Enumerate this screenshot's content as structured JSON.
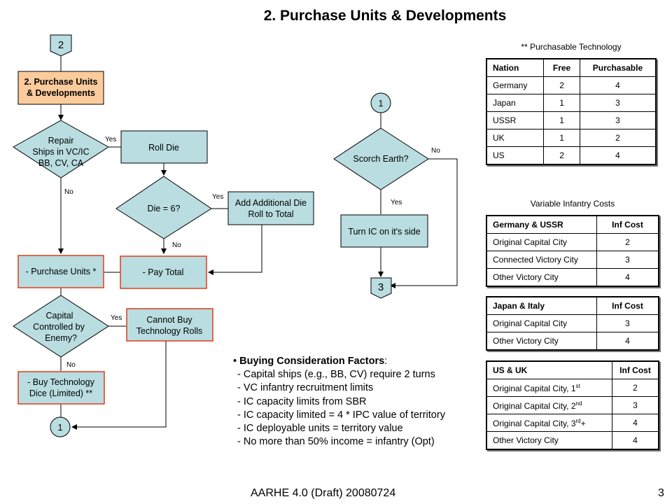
{
  "title": "2. Purchase Units & Developments",
  "flowchart": {
    "start_connector": "2",
    "start_box": [
      "2. Purchase Units",
      "& Developments"
    ],
    "repair_decision": [
      "Repair",
      "Ships in VC/IC",
      "BB, CV, CA"
    ],
    "roll_die": "Roll Die",
    "die6_decision": "Die = 6?",
    "add_die": [
      "Add Additional Die",
      "Roll to Total"
    ],
    "pay_total": "- Pay Total",
    "purchase_units": "- Purchase Units *",
    "capital_decision": [
      "Capital",
      "Controlled by",
      "Enemy?"
    ],
    "cannot_buy": [
      "Cannot Buy",
      "Technology Rolls"
    ],
    "buy_tech": [
      "- Buy Technology",
      "Dice (Limited) **"
    ],
    "connector_1_left": "1",
    "connector_1_right": "1",
    "scorch_decision": "Scorch Earth?",
    "turn_ic": "Turn IC on it's side",
    "end_connector": "3",
    "yes": "Yes",
    "no": "No",
    "colors": {
      "box_fill": "#b9dde0",
      "start_fill": "#fbcb9c",
      "red_border": "#e23b1a"
    }
  },
  "tech_table": {
    "caption": "** Purchasable Technology",
    "headers": [
      "Nation",
      "Free",
      "Purchasable"
    ],
    "rows": [
      [
        "Germany",
        "2",
        "4"
      ],
      [
        "Japan",
        "1",
        "3"
      ],
      [
        "USSR",
        "1",
        "3"
      ],
      [
        "UK",
        "1",
        "2"
      ],
      [
        "US",
        "2",
        "4"
      ]
    ]
  },
  "infantry": {
    "caption": "Variable Infantry Costs",
    "germany_ussr": {
      "headers": [
        "Germany & USSR",
        "Inf Cost"
      ],
      "rows": [
        [
          "Original Capital City",
          "2"
        ],
        [
          "Connected Victory City",
          "3"
        ],
        [
          "Other Victory City",
          "4"
        ]
      ]
    },
    "japan_italy": {
      "headers": [
        "Japan & Italy",
        "Inf Cost"
      ],
      "rows": [
        [
          "Original Capital City",
          "3"
        ],
        [
          "Other Victory City",
          "4"
        ]
      ]
    },
    "us_uk": {
      "headers": [
        "US & UK",
        "Inf Cost"
      ],
      "rows": [
        [
          "Original Capital City, 1",
          "st",
          "2"
        ],
        [
          "Original Capital City, 2",
          "nd",
          "3"
        ],
        [
          "Original Capital City, 3",
          "rd",
          "+",
          "4"
        ],
        [
          "Other Victory City",
          "4"
        ]
      ]
    }
  },
  "factors": {
    "bullet": "•",
    "heading": "Buying Consideration Factors",
    "colon": ":",
    "items": [
      "- Capital ships (e.g., BB, CV) require 2 turns",
      "- VC infantry recruitment limits",
      "- IC capacity limits from SBR",
      "- IC capacity limited = 4 * IPC value of territory",
      "- IC deployable units = territory value",
      "- No more than 50% income = infantry (Opt)"
    ]
  },
  "footer": {
    "text": "AARHE 4.0 (Draft) 20080724",
    "page": "3"
  }
}
